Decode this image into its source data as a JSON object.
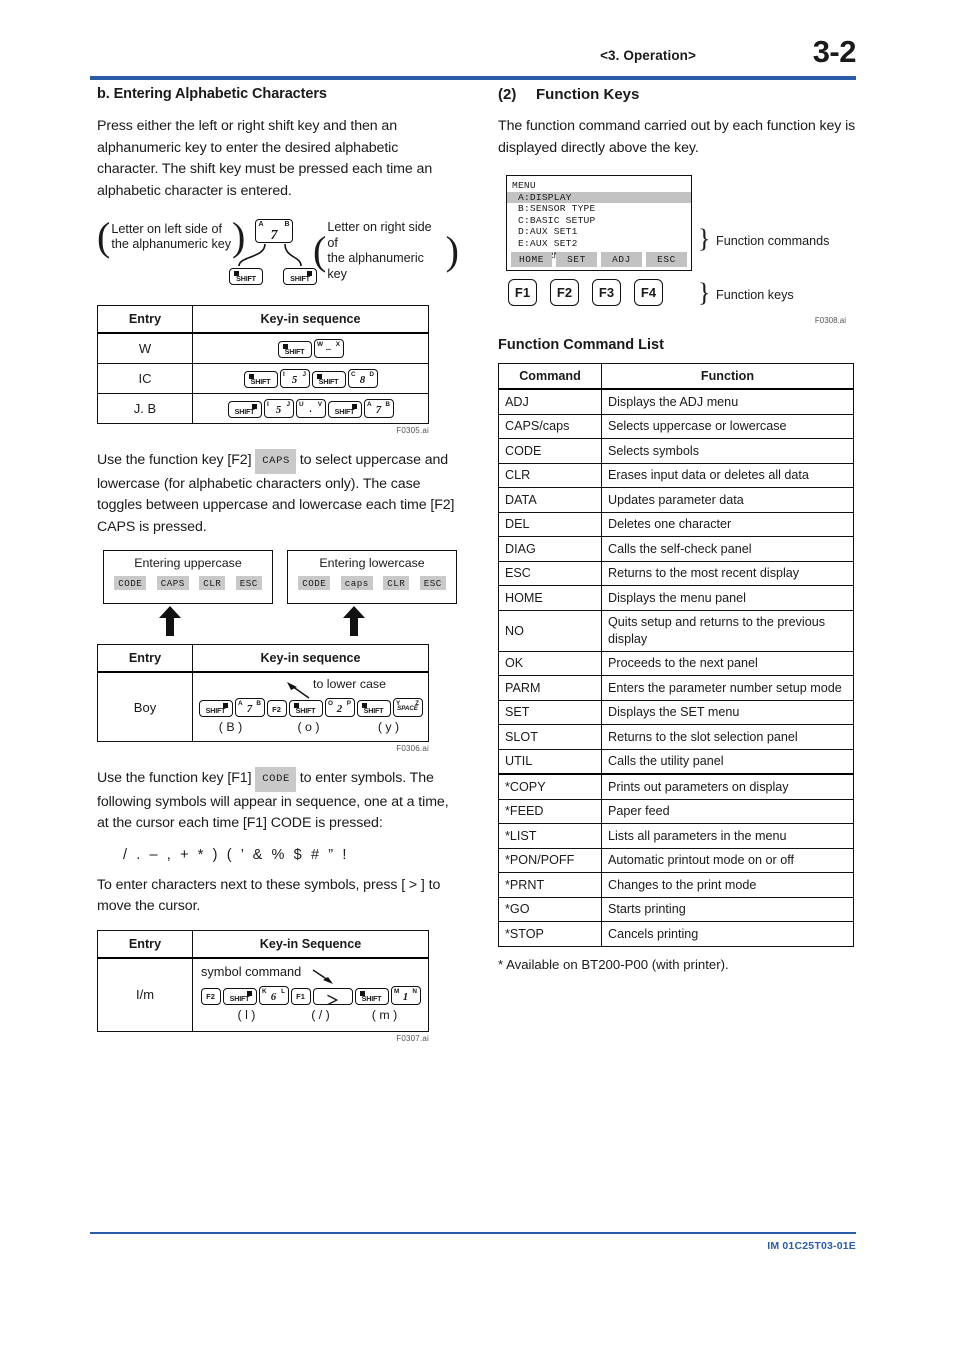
{
  "header": {
    "section": "<3.  Operation>",
    "page_number": "3-2",
    "rule_color": "#2a5caa"
  },
  "left_column": {
    "heading": "b. Entering Alphabetic Characters",
    "intro": "Press either the left or right shift key and then an alphanumeric key to enter the desired alphabetic character. The shift key must be pressed each time an alphabetic character is entered.",
    "shift_figure": {
      "left_label_line1": "Letter on left side of",
      "left_label_line2": "the alphanumeric key",
      "right_label_line1": "Letter on right side of",
      "right_label_line2": "the alphanumeric key",
      "key": {
        "top_left": "A",
        "center": "7",
        "top_right": "B"
      },
      "shift_left_label": "SHIFT",
      "shift_right_label": "SHIFT"
    },
    "table1": {
      "headers": [
        "Entry",
        "Key-in sequence"
      ],
      "fig_id": "F0305.ai",
      "rows": [
        {
          "entry": "W",
          "keys": [
            {
              "type": "shift",
              "label": "SHIFT",
              "marker": "left"
            },
            {
              "type": "alnum",
              "tl": "W",
              "center": "–",
              "tr": "X",
              "center_style": "dash"
            }
          ]
        },
        {
          "entry": "IC",
          "keys": [
            {
              "type": "shift",
              "label": "SHIFT",
              "marker": "left"
            },
            {
              "type": "alnum",
              "tl": "I",
              "center": "5",
              "tr": "J"
            },
            {
              "type": "shift",
              "label": "SHIFT",
              "marker": "left"
            },
            {
              "type": "alnum",
              "tl": "C",
              "center": "8",
              "tr": "D"
            }
          ]
        },
        {
          "entry": "J. B",
          "keys": [
            {
              "type": "shift",
              "label": "SHIFT",
              "marker": "right"
            },
            {
              "type": "alnum",
              "tl": "I",
              "center": "5",
              "tr": "J"
            },
            {
              "type": "alnum",
              "tl": "U",
              "center": ".",
              "tr": "V",
              "center_style": "dot"
            },
            {
              "type": "shift",
              "label": "SHIFT",
              "marker": "right"
            },
            {
              "type": "alnum",
              "tl": "A",
              "center": "7",
              "tr": "B"
            }
          ]
        }
      ]
    },
    "caps_paragraph_part1": "Use the function key [F2]",
    "caps_chip": "CAPS",
    "caps_paragraph_part2": "to select uppercase and lowercase (for alphabetic characters only). The case toggles between uppercase and lowercase each time [F2] CAPS is pressed.",
    "case_figure": {
      "uppercase_title": "Entering uppercase",
      "lowercase_title": "Entering lowercase",
      "uppercase_buttons": [
        "CODE",
        "CAPS",
        "CLR",
        "ESC"
      ],
      "lowercase_buttons": [
        "CODE",
        "caps",
        "CLR",
        "ESC"
      ]
    },
    "table2": {
      "headers": [
        "Entry",
        "Key-in sequence"
      ],
      "fig_id": "F0306.ai",
      "annotation": "to lower case",
      "row": {
        "entry": "Boy",
        "keys": [
          {
            "type": "shift",
            "label": "SHIFT",
            "marker": "right"
          },
          {
            "type": "alnum",
            "tl": "A",
            "center": "7",
            "tr": "B"
          },
          {
            "type": "fn",
            "label": "F2"
          },
          {
            "type": "shift",
            "label": "SHIFT",
            "marker": "left"
          },
          {
            "type": "alnum",
            "tl": "O",
            "center": "2",
            "tr": "P"
          },
          {
            "type": "shift",
            "label": "SHIFT",
            "marker": "left"
          },
          {
            "type": "alnum",
            "tl": "Y",
            "center": "SPACE",
            "tr": "Z",
            "center_style": "small"
          }
        ],
        "under_labels": [
          "( B )",
          "( o )",
          "( y )"
        ]
      }
    },
    "code_paragraph_part1": "Use the function key [F1]",
    "code_chip": "CODE",
    "code_paragraph_part2": "to enter symbols. The following symbols will appear in sequence, one at a time, at the cursor each time [F1] CODE is pressed:",
    "symbols": "/ . – , + * ) ( ’ & % $ # ” !",
    "cursor_paragraph": "To enter characters next to these symbols, press [ > ] to move the cursor.",
    "table3": {
      "headers": [
        "Entry",
        "Key-in Sequence"
      ],
      "fig_id": "F0307.ai",
      "annotation": "symbol command",
      "row": {
        "entry": "I/m",
        "keys": [
          {
            "type": "fn",
            "label": "F2"
          },
          {
            "type": "shift",
            "label": "SHIFT",
            "marker": "right"
          },
          {
            "type": "alnum",
            "tl": "K",
            "center": "6",
            "tr": "L"
          },
          {
            "type": "fn",
            "label": "F1"
          },
          {
            "type": "gt",
            "label": "＞"
          },
          {
            "type": "shift",
            "label": "SHIFT",
            "marker": "left"
          },
          {
            "type": "alnum",
            "tl": "M",
            "center": "1",
            "tr": "N"
          }
        ],
        "under_labels": [
          "( l )",
          "( / )",
          "( m )"
        ]
      }
    }
  },
  "right_column": {
    "section_number": "(2)",
    "section_title": "Function Keys",
    "intro": "The function command carried out by each function key is displayed directly above the key.",
    "menu_figure": {
      "fig_id": "F0308.ai",
      "lcd_title": "MENU",
      "lcd_items": [
        {
          "text": "A:DISPLAY",
          "highlighted": true
        },
        {
          "text": "B:SENSOR TYPE",
          "highlighted": false
        },
        {
          "text": "C:BASIC SETUP",
          "highlighted": false
        },
        {
          "text": "D:AUX SET1",
          "highlighted": false
        },
        {
          "text": "E:AUX SET2",
          "highlighted": false
        },
        {
          "text": "G:ALARM SET",
          "highlighted": false
        }
      ],
      "function_commands": [
        "HOME",
        "SET",
        "ADJ",
        "ESC"
      ],
      "function_keys": [
        "F1",
        "F2",
        "F3",
        "F4"
      ],
      "label_commands": "Function commands",
      "label_keys": "Function keys"
    },
    "command_list": {
      "title": "Function Command List",
      "headers": [
        "Command",
        "Function"
      ],
      "rows": [
        {
          "command": "ADJ",
          "function": "Displays the ADJ menu"
        },
        {
          "command": "CAPS/caps",
          "function": "Selects uppercase or lowercase"
        },
        {
          "command": "CODE",
          "function": "Selects symbols"
        },
        {
          "command": "CLR",
          "function": "Erases input data or deletes all data"
        },
        {
          "command": "DATA",
          "function": "Updates parameter data"
        },
        {
          "command": "DEL",
          "function": "Deletes one character"
        },
        {
          "command": "DIAG",
          "function": "Calls the self-check panel"
        },
        {
          "command": "ESC",
          "function": "Returns to the most recent display"
        },
        {
          "command": "HOME",
          "function": "Displays the menu panel"
        },
        {
          "command": "NO",
          "function": "Quits setup and returns to the previous display"
        },
        {
          "command": "OK",
          "function": "Proceeds to the next panel"
        },
        {
          "command": "PARM",
          "function": "Enters the parameter number setup mode"
        },
        {
          "command": "SET",
          "function": "Displays the SET menu"
        },
        {
          "command": "SLOT",
          "function": "Returns to the slot selection panel"
        },
        {
          "command": "UTIL",
          "function": "Calls the utility panel"
        },
        {
          "command": "*COPY",
          "function": "Prints out parameters on display",
          "divider": true
        },
        {
          "command": "*FEED",
          "function": "Paper feed"
        },
        {
          "command": "*LIST",
          "function": "Lists all parameters in the menu"
        },
        {
          "command": "*PON/POFF",
          "function": "Automatic printout mode on or off"
        },
        {
          "command": "*PRNT",
          "function": "Changes to the print mode"
        },
        {
          "command": "*GO",
          "function": "Starts printing"
        },
        {
          "command": "*STOP",
          "function": "Cancels printing"
        }
      ],
      "footnote": "* Available on BT200-P00 (with printer)."
    }
  },
  "footer": {
    "document_id": "IM 01C25T03-01E",
    "color": "#2a5caa"
  }
}
